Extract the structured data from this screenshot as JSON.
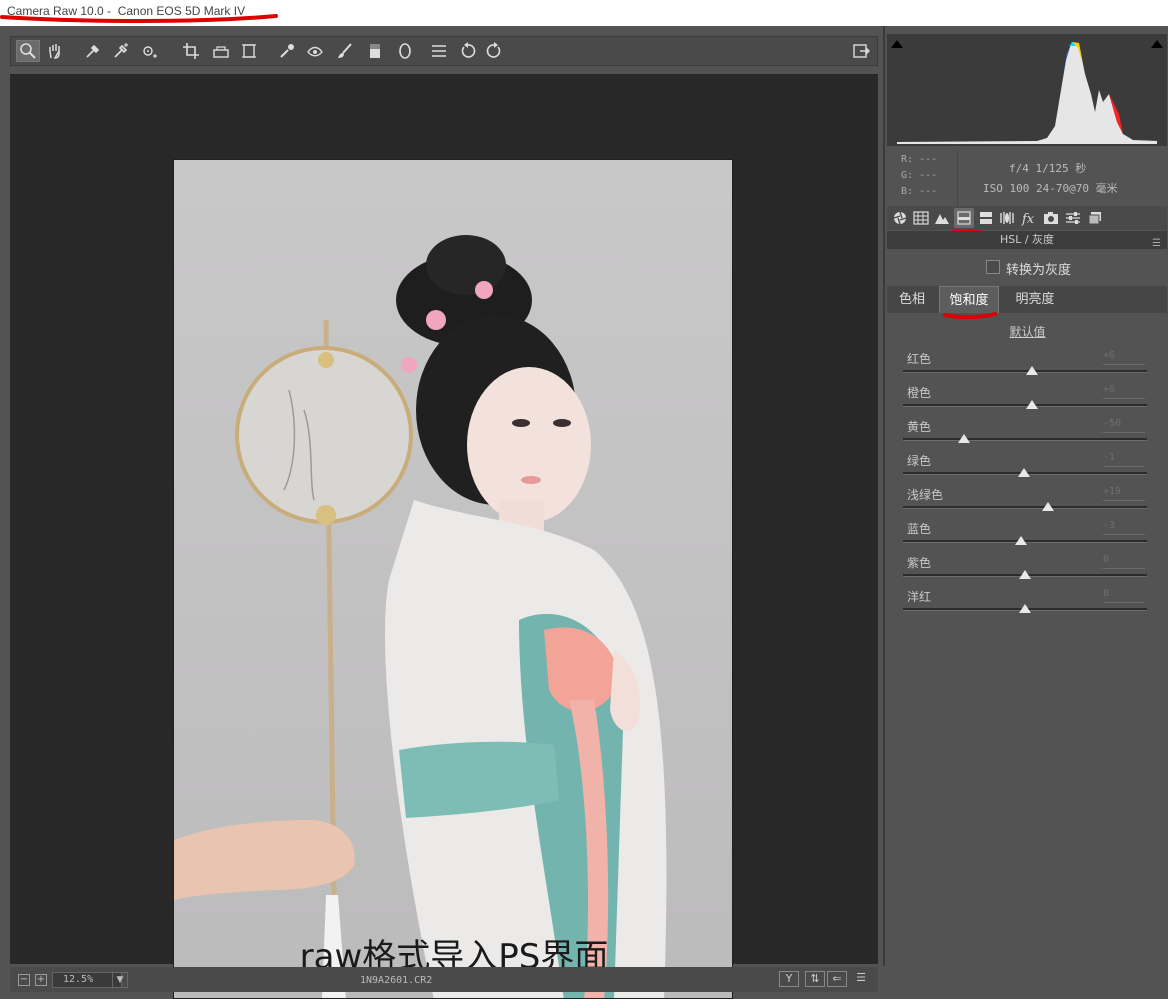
{
  "window": {
    "app_title": "Camera Raw 10.0 - ",
    "camera_title": " Canon EOS 5D Mark IV"
  },
  "toolbar": {
    "tools": [
      "zoom-icon",
      "hand-icon",
      "white-balance-icon",
      "color-sampler-icon",
      "targeted-adjust-icon",
      "crop-icon",
      "straighten-icon",
      "transform-icon",
      "spot-removal-icon",
      "red-eye-icon",
      "adjustment-brush-icon",
      "graduated-filter-icon",
      "radial-filter-icon",
      "presets-list-icon",
      "rotate-ccw-icon",
      "rotate-cw-icon"
    ],
    "open_icon": "export-icon"
  },
  "photo": {
    "caption": "raw格式导入PS界面"
  },
  "status": {
    "zoom": "12.5%",
    "filename": "1N9A2601.CR2",
    "y_label": "Y"
  },
  "info": {
    "r_label": "R:",
    "g_label": "G:",
    "b_label": "B:",
    "rgb_placeholder": "---",
    "exposure": "f/4  1/125 秒",
    "iso_lens": "ISO 100  24-70@70 毫米"
  },
  "panel": {
    "section_title": "HSL / 灰度",
    "convert_gray": "转换为灰度",
    "tabs": [
      "色相",
      "饱和度",
      "明亮度"
    ],
    "active_tab": "饱和度",
    "default_link": "默认值",
    "sliders": [
      {
        "label": "红色",
        "value": "+6",
        "pos": 6
      },
      {
        "label": "橙色",
        "value": "+6",
        "pos": 6
      },
      {
        "label": "黄色",
        "value": "-50",
        "pos": -50
      },
      {
        "label": "绿色",
        "value": "-1",
        "pos": -1
      },
      {
        "label": "浅绿色",
        "value": "+19",
        "pos": 19
      },
      {
        "label": "蓝色",
        "value": "-3",
        "pos": -3
      },
      {
        "label": "紫色",
        "value": "0",
        "pos": 0
      },
      {
        "label": "洋红",
        "value": "0",
        "pos": 0
      }
    ]
  },
  "colors": {
    "annotation_red": "#e00000",
    "panel_bg": "#535353",
    "canvas_bg": "#282828"
  }
}
